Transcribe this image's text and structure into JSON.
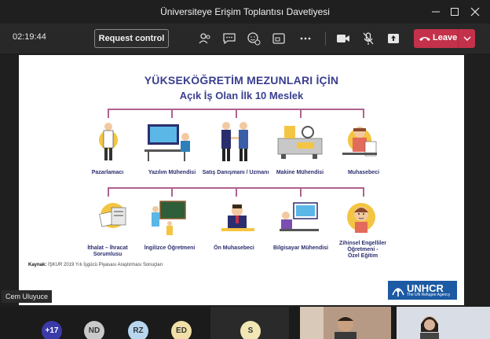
{
  "window": {
    "title": "Üniversiteye Erişim Toplantısı Davetiyesi",
    "controls": [
      "minimize",
      "maximize",
      "close"
    ]
  },
  "toolbar": {
    "timer": "02:19:44",
    "request_control_label": "Request control",
    "leave_label": "Leave",
    "icons": [
      "people-icon",
      "chat-icon",
      "reactions-icon",
      "share-tray-icon",
      "more-icon",
      "camera-icon",
      "mic-off-icon",
      "share-icon"
    ]
  },
  "slide": {
    "title_line1": "YÜKSEKÖĞRETİM MEZUNLARI İÇİN",
    "title_line2": "Açık İş Olan İlk 10 Meslek",
    "row1": [
      "Pazarlamacı",
      "Yazılım Mühendisi",
      "Satış Danışmanı / Uzmanı",
      "Makine Mühendisi",
      "Muhasebeci"
    ],
    "row2": [
      [
        "İthalat – İhracat",
        "Sorumlusu"
      ],
      [
        "İngilizce Öğretmeni"
      ],
      [
        "Ön Muhasebeci"
      ],
      [
        "Bilgisayar Mühendisi"
      ],
      [
        "Zihinsel Engelliler",
        "Öğretmeni -",
        "Özel Eğitim"
      ]
    ],
    "source_label": "Kaynak:",
    "source_text": "İŞKUR 2019 Yılı İşgücü Piyasası Araştırması Sonuçları",
    "logo_text": "UNHCR",
    "logo_sub": "The UN Refugee Agency",
    "accent_color": "#b0628f",
    "title_color": "#3a3f8f"
  },
  "presenter": {
    "name": "Cem Uluyuce"
  },
  "participants": {
    "overflow": "+17",
    "avatars": [
      {
        "initials": "ND",
        "color": "#c9c9c9"
      },
      {
        "initials": "RZ",
        "color": "#b8d6f0"
      },
      {
        "initials": "ED",
        "color": "#f0e0a8"
      },
      {
        "initials": "S",
        "color": "#f2e6b4"
      }
    ]
  }
}
